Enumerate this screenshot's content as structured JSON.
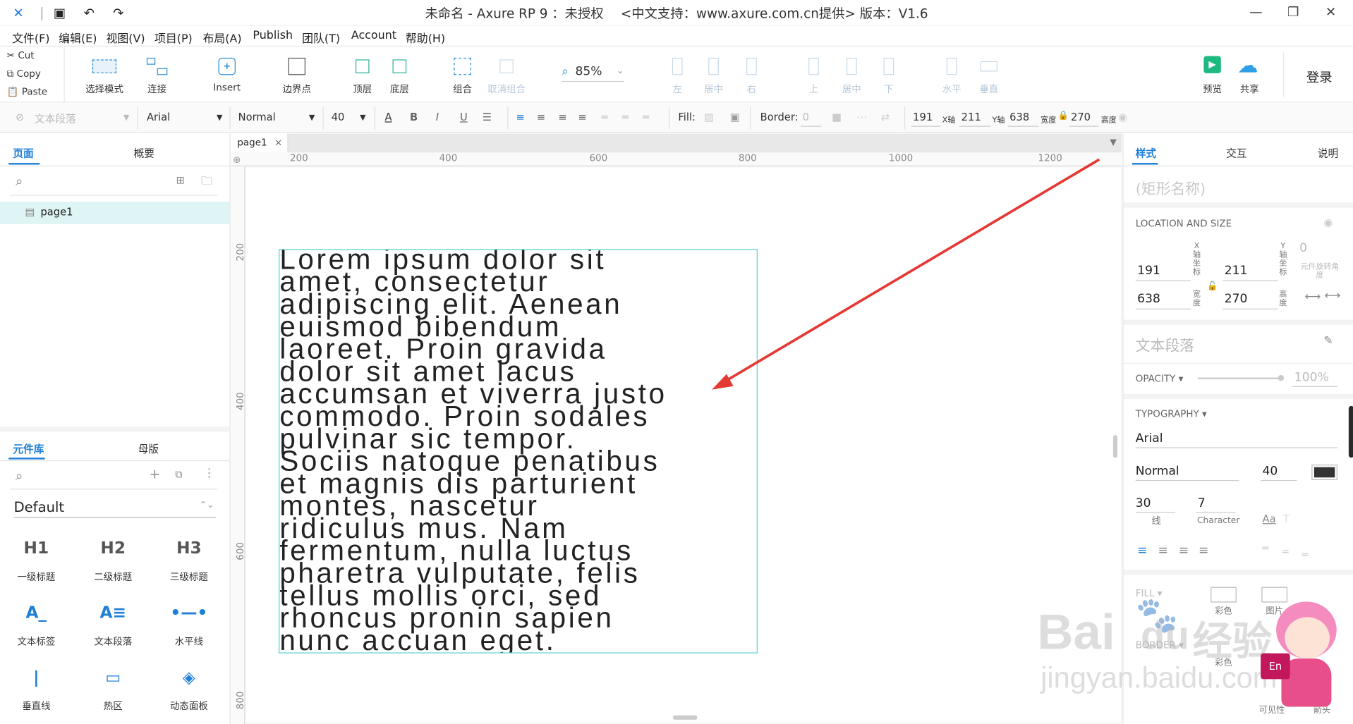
{
  "titlebar": {
    "title": "未命名 - Axure RP 9 ：未授权 　<中文支持：www.axure.com.cn提供> 版本：V1.6",
    "min": "—",
    "max": "❐",
    "close": "✕"
  },
  "menu": [
    "文件(F)",
    "编辑(E)",
    "视图(V)",
    "项目(P)",
    "布局(A)",
    "Publish",
    "团队(T)",
    "Account",
    "帮助(H)"
  ],
  "clipboard": {
    "cut": "Cut",
    "copy": "Copy",
    "paste": "Paste"
  },
  "toolbar": {
    "select_mode": "选择模式",
    "connect": "连接",
    "insert": "Insert",
    "boundary": "边界点",
    "top_layer": "顶层",
    "bottom_layer": "底层",
    "group": "组合",
    "ungroup": "取消组合",
    "zoom": "85%",
    "align_left": "左",
    "align_center": "居中",
    "align_right": "右",
    "align_top": "上",
    "align_middle": "居中",
    "align_bottom": "下",
    "dist_h": "水平",
    "dist_v": "垂直",
    "preview": "预览",
    "share": "共享",
    "login": "登录"
  },
  "format": {
    "style": "文本段落",
    "font": "Arial",
    "weight": "Normal",
    "size": "40",
    "fill_label": "Fill:",
    "border_label": "Border:",
    "border_width": "0",
    "x": "191",
    "x_label": "X轴",
    "y": "211",
    "y_label": "Y轴",
    "w": "638",
    "w_label": "宽度",
    "h": "270",
    "h_label": "高度"
  },
  "left": {
    "tab_pages": "页面",
    "tab_outline": "概要",
    "page_item": "page1",
    "tab_library": "元件库",
    "tab_masters": "母版",
    "library_name": "Default",
    "widgets": [
      {
        "icon": "H1",
        "label": "一级标题"
      },
      {
        "icon": "H2",
        "label": "二级标题"
      },
      {
        "icon": "H3",
        "label": "三级标题"
      },
      {
        "icon": "A_",
        "label": "文本标签"
      },
      {
        "icon": "A≡",
        "label": "文本段落"
      },
      {
        "icon": "•—•",
        "label": "水平线"
      },
      {
        "icon": "|",
        "label": "垂直线"
      },
      {
        "icon": "▭",
        "label": "热区"
      },
      {
        "icon": "◈",
        "label": "动态面板"
      }
    ]
  },
  "canvas": {
    "tab": "page1",
    "ruler_top": [
      "200",
      "400",
      "600",
      "800",
      "1000",
      "1200"
    ],
    "ruler_left": [
      "200",
      "400",
      "600",
      "800"
    ],
    "text": "Lorem ipsum dolor sit\namet, consectetur\nadipiscing elit. Aenean\neuismod bibendum\nlaoreet. Proin gravida\ndolor sit amet lacus\naccumsan et viverra justo\ncommodo. Proin sodales\npulvinar sic tempor.\nSociis natoque penatibus\net magnis dis parturient\nmontes, nascetur\nridiculus mus. Nam\nfermentum, nulla luctus\npharetra vulputate, felis\ntellus mollis orci, sed\nrhoncus pronin sapien\nnunc accuan eget."
  },
  "right": {
    "tab_style": "样式",
    "tab_interact": "交互",
    "tab_notes": "说明",
    "shape_name": "(矩形名称)",
    "loc_size": "LOCATION AND SIZE",
    "x": "191",
    "y": "211",
    "rot": "0",
    "w": "638",
    "h": "270",
    "x_sub": "X\n轴\n坐\n标",
    "y_sub": "Y\n轴\n坐\n标",
    "w_sub": "宽\n度",
    "h_sub": "高\n度",
    "rot_sub": "元件旋转角\n度",
    "style_name": "文本段落",
    "opacity_label": "OPACITY ▾",
    "opacity": "100%",
    "typography": "TYPOGRAPHY ▾",
    "font": "Arial",
    "weight": "Normal",
    "size": "40",
    "line": "30",
    "line_label": "线",
    "char": "7",
    "char_label": "Character",
    "fill": "FILL ▾",
    "fill_color": "彩色",
    "fill_image": "图片",
    "border": "BORDER ▾",
    "border_color": "彩色",
    "visible": "可见性",
    "arrow": "箭头"
  },
  "watermark": {
    "brand": "Bai",
    "paw": "du",
    "jy": "经验",
    "url": "jingyan.baidu.com",
    "en": "En"
  },
  "colors": {
    "accent": "#1f7fd6",
    "selection": "#4fd1d1",
    "arrow": "#e53935"
  }
}
